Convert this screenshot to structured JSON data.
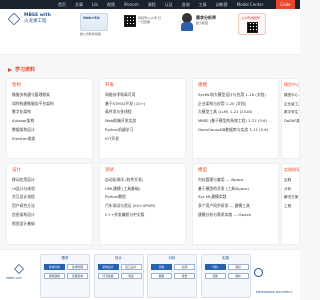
{
  "nav": [
    "首页",
    "文章",
    "Lib",
    "视频",
    "iPenom",
    "课程",
    "认证",
    "咨询",
    "工具",
    "训练营",
    "Model Center",
    "Code"
  ],
  "nav_active_index": 11,
  "header": {
    "logo_title": "MBSE with",
    "logo_subtitle": "火龙果工程",
    "promos": [
      {
        "label": "Web+EA",
        "caption": "嵌入式软件建模"
      },
      {
        "caption": "视频号/公众号 扫一扫查看"
      },
      {
        "title": "需求分析师",
        "caption": "能力模型"
      },
      {
        "label": "公众号/视频号"
      }
    ]
  },
  "section": {
    "title": "学习资料"
  },
  "panels": [
    {
      "title": "架构",
      "items": [
        "微服务构建与管理框架",
        "如何构建微服务平台架构",
        "数字化架构",
        "Autosar架构",
        "数据架构设计",
        "Electron框架"
      ]
    },
    {
      "title": "开发",
      "items": [
        "网络技术和高可用",
        "基于STM32开发 (10+)",
        "高并发与多线程",
        "Web前端开发实战",
        "Python机器学习",
        "IOT开发"
      ]
    },
    {
      "title": "建模",
      "items": [
        "SysML和大模型设计与应用 1-16 (文档)",
        "企业架构与应用 1-20 (文档)",
        "大模型工具 (LLM) 1-22 (2018)",
        "MBSE (基于模型的系统工程) 2-27 (5.6)",
        "OpenGaussDB数据库与实战 3-11 (5.6)"
      ]
    },
    {
      "title": "设计",
      "items": [
        "移动应用设计",
        "UI设计与体验",
        "交互设计流程",
        "用户研究方法",
        "信息架构设计",
        "视觉设计基础"
      ]
    },
    {
      "title": "测试",
      "items": [
        "自动化测试 (软件开发)",
        "UML建模 (工具基础)",
        "Python教程",
        "汽车测试与验证 (EA+UPDM)",
        "C++并发编程与中文版"
      ]
    },
    {
      "title": "模型",
      "items": [
        "内存管理与复用 — iSpace",
        "基于模型的开发 (工具iSpace)",
        "Sys ML建模实践",
        "多个用户同步研发 — 建模工具",
        "建模分析与需求实践 — iSpace"
      ]
    }
  ],
  "sidebar": [
    {
      "title": "模型中心",
      "items": [
        "模型中心",
        "企业级工程",
        "数字孪生",
        "DoDAF建模"
      ]
    },
    {
      "title": "实践指导",
      "items": [
        "实践",
        "分析",
        "解决方案",
        "工程"
      ]
    }
  ],
  "bottom": {
    "left_caption": "MBSE with",
    "groups": [
      {
        "title": "需求",
        "cells": [
          "需求分析",
          "需求管理",
          "用例建模",
          "功能需求"
        ]
      },
      {
        "title": "设计",
        "cells": [
          "架构设计",
          "接口设计",
          "行为建模",
          "验证"
        ]
      },
      {
        "title": "分析",
        "cells": [
          "仿真",
          "追溯",
          "数据",
          "报告"
        ]
      },
      {
        "title": "实施",
        "cells": [
          "代码",
          "测试",
          "部署",
          "维护"
        ]
      }
    ],
    "right_label": "ENTERPRISE ARCHITECT"
  }
}
